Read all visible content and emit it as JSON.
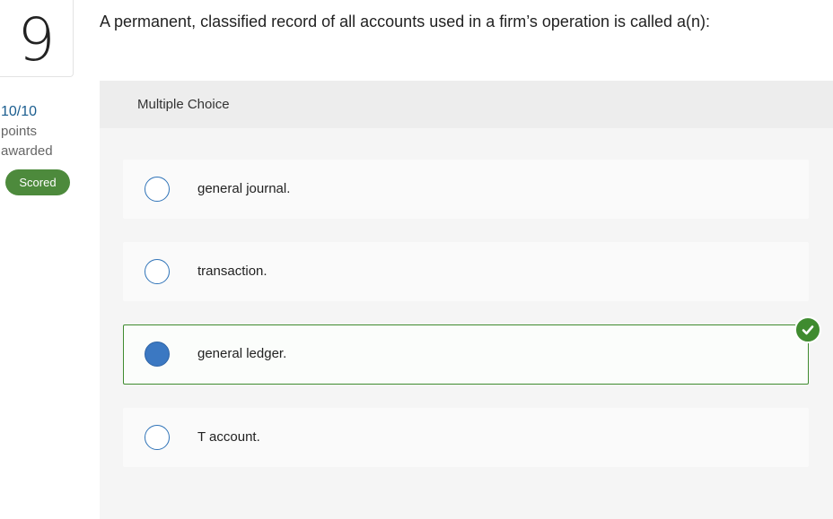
{
  "question": {
    "number": "9",
    "text": "A permanent, classified record of all accounts used in a firm’s operation is called a(n):"
  },
  "score": {
    "value": "10/10",
    "label_line1": "points",
    "label_line2": "awarded",
    "badge": "Scored"
  },
  "panel": {
    "header": "Multiple Choice",
    "choices": [
      {
        "label": "general journal.",
        "selected": false,
        "correct": false
      },
      {
        "label": "transaction.",
        "selected": false,
        "correct": false
      },
      {
        "label": "general ledger.",
        "selected": true,
        "correct": true
      },
      {
        "label": "T account.",
        "selected": false,
        "correct": false
      }
    ]
  },
  "colors": {
    "accent": "#1a5d8f",
    "badge_green": "#4d8a3c",
    "correct_border": "#3f8b2f",
    "radio_selected": "#3b78c2"
  },
  "icons": {
    "correct_marker": "checkmark-circle-icon"
  }
}
